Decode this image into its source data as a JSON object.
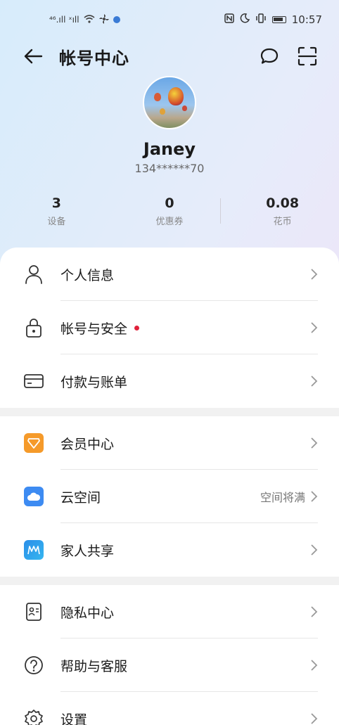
{
  "status": {
    "network": "⁴⁶.ıll ˣıll",
    "time": "10:57"
  },
  "header": {
    "title": "帐号中心"
  },
  "user": {
    "name": "Janey",
    "phone": "134******70"
  },
  "stats": [
    {
      "value": "3",
      "label": "设备"
    },
    {
      "value": "0",
      "label": "优惠券"
    },
    {
      "value": "0.08",
      "label": "花币"
    }
  ],
  "groups": {
    "g1": [
      {
        "label": "个人信息",
        "icon": "person-icon"
      },
      {
        "label": "帐号与安全",
        "icon": "lock-icon",
        "dot": true
      },
      {
        "label": "付款与账单",
        "icon": "card-icon"
      }
    ],
    "g2": [
      {
        "label": "会员中心",
        "icon": "vip-icon"
      },
      {
        "label": "云空间",
        "icon": "cloud-icon",
        "extra": "空间将满"
      },
      {
        "label": "家人共享",
        "icon": "family-icon"
      }
    ],
    "g3": [
      {
        "label": "隐私中心",
        "icon": "privacy-icon"
      },
      {
        "label": "帮助与客服",
        "icon": "help-icon"
      },
      {
        "label": "设置",
        "icon": "gear-icon"
      }
    ]
  },
  "colors": {
    "accent_red": "#e0213b",
    "vip_orange": "#f59a2a",
    "cloud_blue": "#3d8bf2",
    "family_blue": "#2b8ee8"
  }
}
